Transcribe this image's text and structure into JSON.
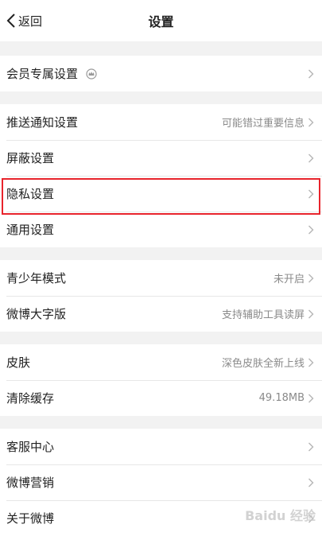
{
  "header": {
    "back_label": "返回",
    "title": "设置"
  },
  "groups": [
    {
      "rows": [
        {
          "label": "会员专属设置",
          "value": ""
        }
      ]
    },
    {
      "rows": [
        {
          "label": "推送通知设置",
          "value": "可能错过重要信息"
        },
        {
          "label": "屏蔽设置",
          "value": ""
        },
        {
          "label": "隐私设置",
          "value": ""
        },
        {
          "label": "通用设置",
          "value": ""
        }
      ]
    },
    {
      "rows": [
        {
          "label": "青少年模式",
          "value": "未开启"
        },
        {
          "label": "微博大字版",
          "value": "支持辅助工具读屏"
        }
      ]
    },
    {
      "rows": [
        {
          "label": "皮肤",
          "value": "深色皮肤全新上线"
        },
        {
          "label": "清除缓存",
          "value": "49.18MB"
        }
      ]
    },
    {
      "rows": [
        {
          "label": "客服中心",
          "value": ""
        },
        {
          "label": "微博营销",
          "value": ""
        },
        {
          "label": "关于微博",
          "value": ""
        }
      ]
    }
  ],
  "highlight": {
    "target": "隐私设置",
    "color": "#e8242c"
  },
  "watermark": "Baidu 经验"
}
